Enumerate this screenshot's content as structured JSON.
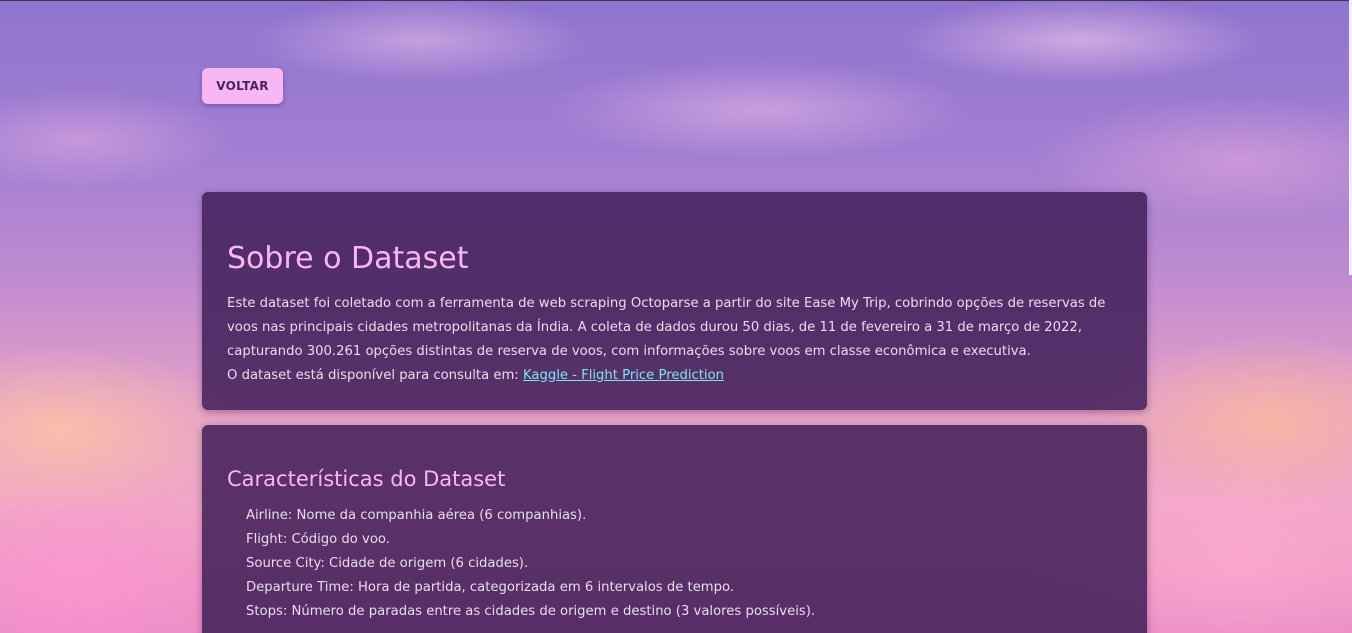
{
  "nav": {
    "back_label": "VOLTAR"
  },
  "about": {
    "title": "Sobre o Dataset",
    "paragraph": "Este dataset foi coletado com a ferramenta de web scraping Octoparse a partir do site Ease My Trip, cobrindo opções de reservas de voos nas principais cidades metropolitanas da Índia. A coleta de dados durou 50 dias, de 11 de fevereiro a 31 de março de 2022, capturando 300.261 opções distintas de reserva de voos, com informações sobre voos em classe econômica e executiva.",
    "availability_text": "O dataset está disponível para consulta em: ",
    "link_label": "Kaggle - Flight Price Prediction"
  },
  "features": {
    "title": "Características do Dataset",
    "items": [
      {
        "label": "Airline: Nome da companhia aérea (6 companhias)."
      },
      {
        "label": "Flight: Código do voo."
      },
      {
        "label": "Source City: Cidade de origem (6 cidades)."
      },
      {
        "label": "Departure Time: Hora de partida, categorizada em 6 intervalos de tempo."
      },
      {
        "label": "Stops: Número de paradas entre as cidades de origem e destino (3 valores possíveis)."
      }
    ]
  },
  "colors": {
    "card_background": "#401e58",
    "heading": "#fbb6f2",
    "body_text": "#eadbed",
    "link": "#7fe3ee",
    "button_background": "#f7b7f4",
    "button_text": "#4a245a"
  }
}
